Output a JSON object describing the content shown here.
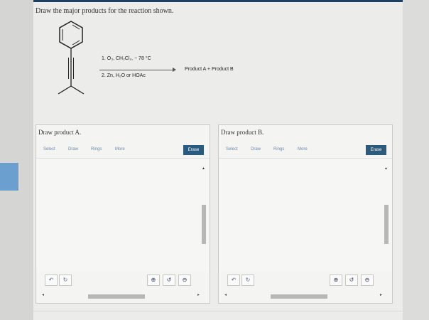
{
  "question": {
    "prompt": "Draw the major products for the reaction shown."
  },
  "reaction": {
    "condition1": "1. O₃, CH₂Cl₂, − 78 °C",
    "condition2": "2. Zn, H₂O or HOAc",
    "products": "Product A  +  Product B"
  },
  "panels": [
    {
      "title": "Draw product A.",
      "tools": [
        "Select",
        "Draw",
        "Rings",
        "More"
      ],
      "erase": "Erase",
      "icons": {
        "undo": "undo-icon",
        "redo": "redo-icon",
        "zoom_in": "zoom-in-icon",
        "reset": "reset-zoom-icon",
        "zoom_out": "zoom-out-icon"
      }
    },
    {
      "title": "Draw product B.",
      "tools": [
        "Select",
        "Draw",
        "Rings",
        "More"
      ],
      "erase": "Erase",
      "icons": {
        "undo": "undo-icon",
        "redo": "redo-icon",
        "zoom_in": "zoom-in-icon",
        "reset": "reset-zoom-icon",
        "zoom_out": "zoom-out-icon"
      }
    }
  ],
  "colors": {
    "erase_button": "#2a5a7e",
    "tool_text": "#6a8aa8",
    "left_tab": "#6b9fd0"
  }
}
